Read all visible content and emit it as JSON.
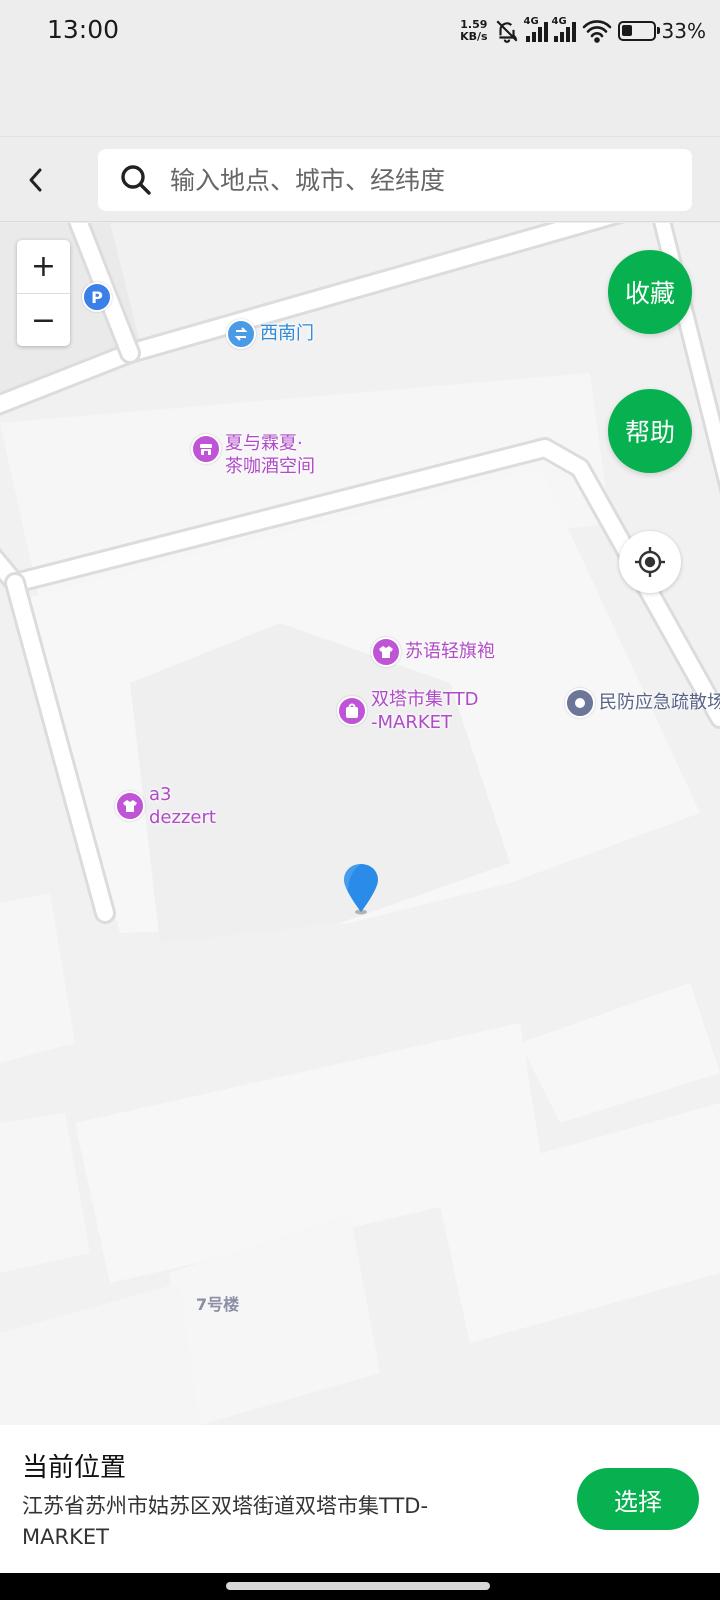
{
  "status_bar": {
    "time": "13:00",
    "net_speed_value": "1.59",
    "net_speed_unit": "KB/s",
    "sim1_label": "4G",
    "sim2_label": "4G",
    "battery_percent": "33%",
    "battery_level": 0.33
  },
  "header": {
    "back_icon": "chevron-left-icon",
    "search_icon": "search-icon",
    "search_placeholder": "输入地点、城市、经纬度"
  },
  "map": {
    "zoom_in_label": "+",
    "zoom_out_label": "−",
    "favorite_label": "收藏",
    "help_label": "帮助",
    "locate_icon": "locate-icon",
    "accent_color": "#07b150",
    "poi_color": "#b04ac8",
    "pois": {
      "parking": "P",
      "west_south_gate": "西南门",
      "tea_cafe_line1": "夏与霖夏·",
      "tea_cafe_line2": "茶咖酒空间",
      "qipao": "苏语轻旗袍",
      "market_line1": "双塔市集TTD",
      "market_line2": "-MARKET",
      "civil_defense": "民防应急疏散场",
      "dessert_line1": "a3",
      "dessert_line2": "dezzert",
      "building7": "7号楼"
    }
  },
  "bottom": {
    "title": "当前位置",
    "address": "江苏省苏州市姑苏区双塔街道双塔市集TTD-MARKET",
    "select_label": "选择"
  }
}
